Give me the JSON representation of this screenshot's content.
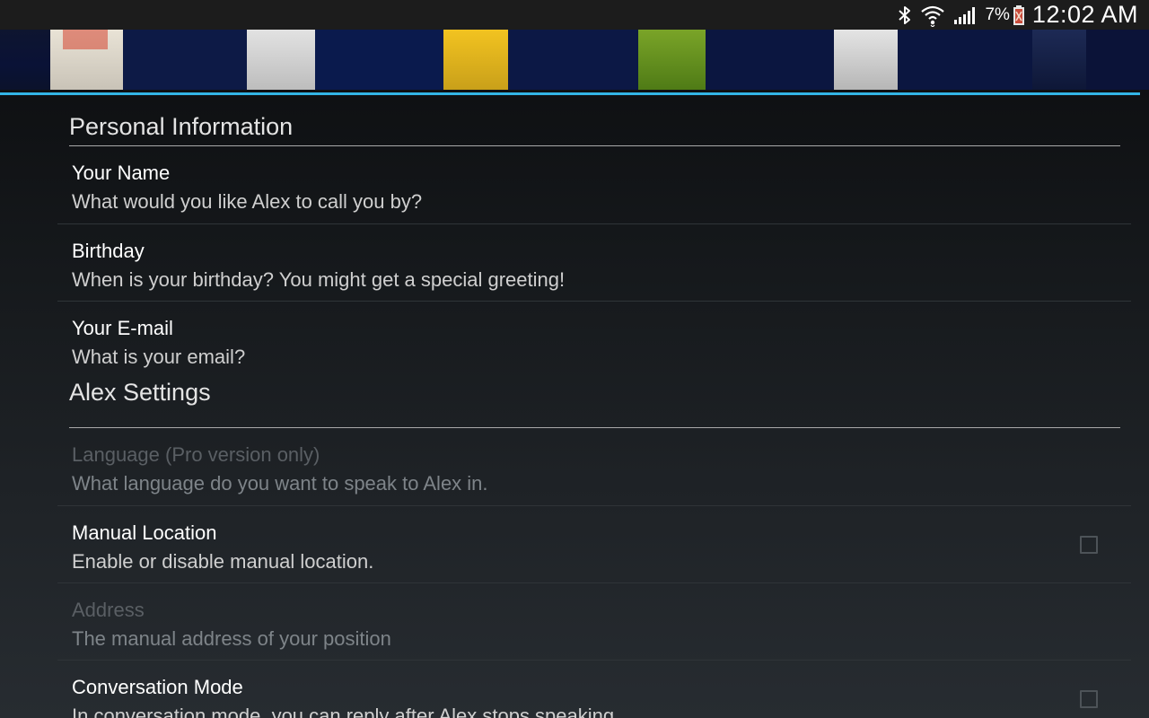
{
  "status_bar": {
    "icons": [
      "bluetooth-icon",
      "wifi-icon",
      "signal-icon",
      "battery-low-icon"
    ],
    "battery_percent": "7%",
    "time": "12:02 AM"
  },
  "colors": {
    "accent": "#33b5e5",
    "background_top": "#0b0c0e",
    "background_bottom": "#272c31",
    "title_text": "#ffffff",
    "summary_text": "#cfcfcf",
    "disabled_text": "#5a5f64"
  },
  "categories": [
    {
      "title": "Personal Information",
      "items": [
        {
          "title": "Your Name",
          "summary": "What would you like Alex to call you by?"
        },
        {
          "title": "Birthday",
          "summary": "When is your birthday? You might get a special greeting!"
        },
        {
          "title": "Your E-mail",
          "summary": "What is your email?"
        }
      ]
    },
    {
      "title": "Alex Settings",
      "items": [
        {
          "title": "Language (Pro version only)",
          "summary": "What language do you want to speak to Alex in.",
          "enabled": false
        },
        {
          "title": "Manual Location",
          "summary": "Enable or disable manual location.",
          "checkbox": true,
          "checked": false
        },
        {
          "title": "Address",
          "summary": "The manual address of your position",
          "enabled": false
        },
        {
          "title": "Conversation Mode",
          "summary": "In conversation mode, you can reply after Alex stops speaking.",
          "checkbox": true,
          "checked": false
        }
      ]
    }
  ]
}
